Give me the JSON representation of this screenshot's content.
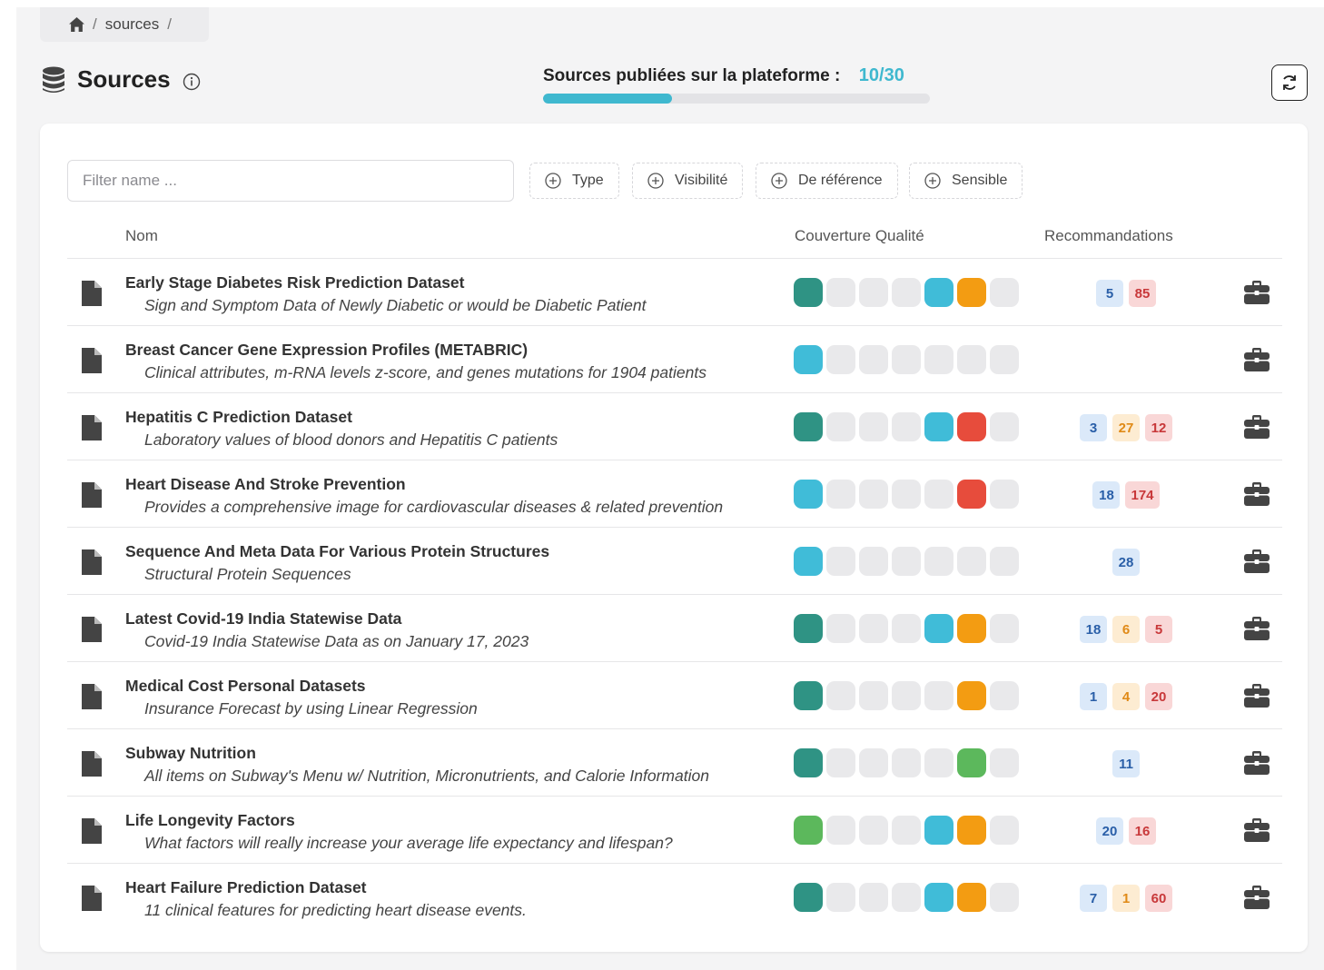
{
  "breadcrumb": {
    "home_icon": "home-icon",
    "items": [
      "sources"
    ]
  },
  "header": {
    "title": "Sources",
    "db_icon": "database-icon",
    "info_icon": "info-icon"
  },
  "progress": {
    "label": "Sources publiées sur la plateforme :",
    "count_text": "10/30",
    "published": 10,
    "total": 30
  },
  "refresh_icon": "refresh-icon",
  "filter": {
    "placeholder": "Filter name ...",
    "value": ""
  },
  "filter_buttons": [
    "Type",
    "Visibilité",
    "De référence",
    "Sensible"
  ],
  "columns": {
    "name": "Nom",
    "coverage": "Couverture Qualité",
    "recos": "Recommandations"
  },
  "colors": {
    "accent": "#3fb8cf",
    "teal": "#2f9384",
    "cyan": "#40bcd8",
    "orange": "#f39c12",
    "red": "#e74c3c",
    "green": "#5cb85c",
    "empty": "#e9e9eb"
  },
  "rows": [
    {
      "name": "Early Stage Diabetes Risk Prediction Dataset",
      "description": "Sign and Symptom Data of Newly Diabetic or would be Diabetic Patient",
      "coverage": [
        "teal",
        "empty",
        "empty",
        "empty",
        "cyan",
        "orange",
        "empty"
      ],
      "recos": [
        {
          "value": "5",
          "kind": "blue"
        },
        {
          "value": "85",
          "kind": "red"
        }
      ]
    },
    {
      "name": "Breast Cancer Gene Expression Profiles (METABRIC)",
      "description": "Clinical attributes, m-RNA levels z-score, and genes mutations for 1904 patients",
      "coverage": [
        "cyan",
        "empty",
        "empty",
        "empty",
        "empty",
        "empty",
        "empty"
      ],
      "recos": []
    },
    {
      "name": "Hepatitis C Prediction Dataset",
      "description": "Laboratory values of blood donors and Hepatitis C patients",
      "coverage": [
        "teal",
        "empty",
        "empty",
        "empty",
        "cyan",
        "red",
        "empty"
      ],
      "recos": [
        {
          "value": "3",
          "kind": "blue"
        },
        {
          "value": "27",
          "kind": "orange"
        },
        {
          "value": "12",
          "kind": "red"
        }
      ]
    },
    {
      "name": "Heart Disease And Stroke Prevention",
      "description": "Provides a comprehensive image for cardiovascular diseases & related prevention",
      "coverage": [
        "cyan",
        "empty",
        "empty",
        "empty",
        "empty",
        "red",
        "empty"
      ],
      "recos": [
        {
          "value": "18",
          "kind": "blue"
        },
        {
          "value": "174",
          "kind": "red"
        }
      ]
    },
    {
      "name": "Sequence And Meta Data For Various Protein Structures",
      "description": "Structural Protein Sequences",
      "coverage": [
        "cyan",
        "empty",
        "empty",
        "empty",
        "empty",
        "empty",
        "empty"
      ],
      "recos": [
        {
          "value": "28",
          "kind": "blue"
        }
      ]
    },
    {
      "name": "Latest Covid-19 India Statewise Data",
      "description": "Covid-19 India Statewise Data as on January 17, 2023",
      "coverage": [
        "teal",
        "empty",
        "empty",
        "empty",
        "cyan",
        "orange",
        "empty"
      ],
      "recos": [
        {
          "value": "18",
          "kind": "blue"
        },
        {
          "value": "6",
          "kind": "orange"
        },
        {
          "value": "5",
          "kind": "red"
        }
      ]
    },
    {
      "name": "Medical Cost Personal Datasets",
      "description": "Insurance Forecast by using Linear Regression",
      "coverage": [
        "teal",
        "empty",
        "empty",
        "empty",
        "empty",
        "orange",
        "empty"
      ],
      "recos": [
        {
          "value": "1",
          "kind": "blue"
        },
        {
          "value": "4",
          "kind": "orange"
        },
        {
          "value": "20",
          "kind": "red"
        }
      ]
    },
    {
      "name": "Subway Nutrition",
      "description": "All items on Subway's Menu w/ Nutrition, Micronutrients, and Calorie Information",
      "coverage": [
        "teal",
        "empty",
        "empty",
        "empty",
        "empty",
        "green",
        "empty"
      ],
      "recos": [
        {
          "value": "11",
          "kind": "blue"
        }
      ]
    },
    {
      "name": "Life Longevity Factors",
      "description": "What factors will really increase your average life expectancy and lifespan?",
      "coverage": [
        "green",
        "empty",
        "empty",
        "empty",
        "cyan",
        "orange",
        "empty"
      ],
      "recos": [
        {
          "value": "20",
          "kind": "blue"
        },
        {
          "value": "16",
          "kind": "red"
        }
      ]
    },
    {
      "name": "Heart Failure Prediction Dataset",
      "description": "11 clinical features for predicting heart disease events.",
      "coverage": [
        "teal",
        "empty",
        "empty",
        "empty",
        "cyan",
        "orange",
        "empty"
      ],
      "recos": [
        {
          "value": "7",
          "kind": "blue"
        },
        {
          "value": "1",
          "kind": "orange"
        },
        {
          "value": "60",
          "kind": "red"
        }
      ]
    }
  ]
}
